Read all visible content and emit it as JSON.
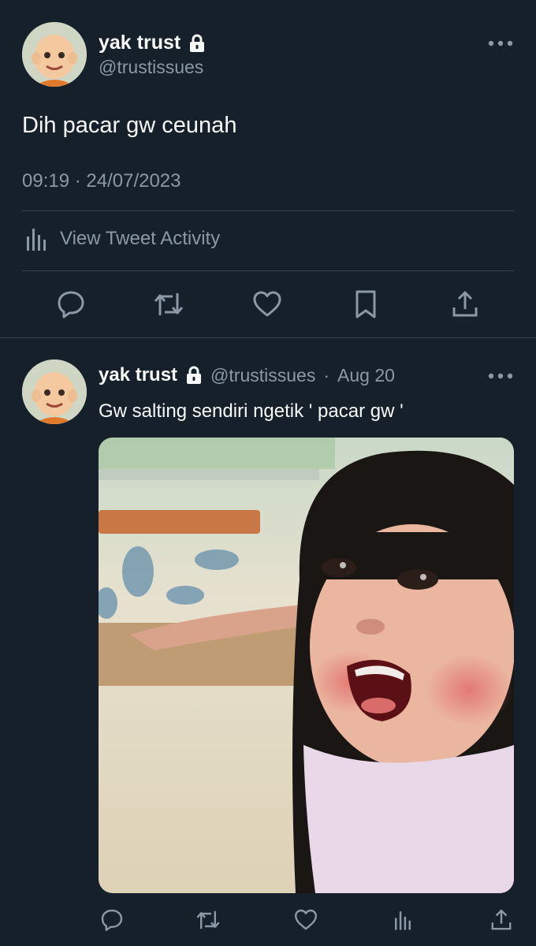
{
  "main_tweet": {
    "display_name": "yak trust",
    "handle": "@trustissues",
    "text": "Dih pacar gw ceunah",
    "timestamp": "09:19 · 24/07/2023",
    "activity_label": "View Tweet Activity",
    "actions": [
      "reply",
      "retweet",
      "like",
      "bookmark",
      "share"
    ]
  },
  "reply_tweet": {
    "display_name": "yak trust",
    "handle": "@trustissues",
    "separator": "·",
    "date": "Aug 20",
    "text": "Gw salting sendiri ngetik ' pacar gw '",
    "media": {
      "type": "image"
    },
    "actions": [
      "reply",
      "retweet",
      "like",
      "views",
      "share"
    ]
  },
  "colors": {
    "background": "#15202b",
    "text": "#f7f9f9",
    "muted": "#8b98a5",
    "divider": "#38444d"
  },
  "icons": {
    "lock": "lock-icon",
    "more": "more-icon",
    "activity": "activity-icon",
    "reply": "reply-icon",
    "retweet": "retweet-icon",
    "like": "like-icon",
    "bookmark": "bookmark-icon",
    "share": "share-icon",
    "views": "views-icon"
  }
}
